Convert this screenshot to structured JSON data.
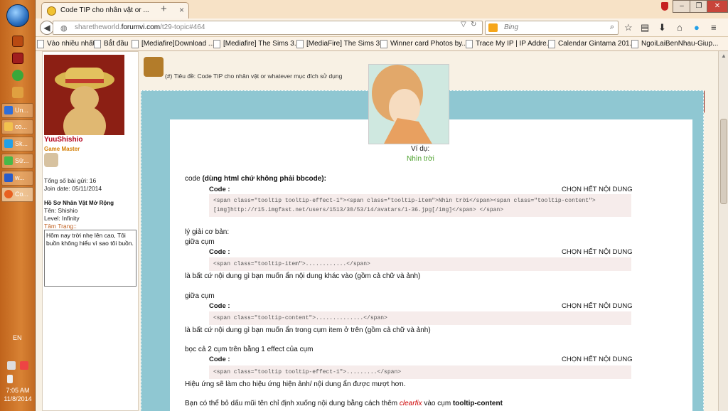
{
  "taskbar": {
    "tasks": [
      {
        "label": "Un...",
        "color": "#2f6ed8"
      },
      {
        "label": "co...",
        "color": "#f2c14e"
      },
      {
        "label": "Sk...",
        "color": "#22a0e8"
      },
      {
        "label": "Sử...",
        "color": "#48b848"
      },
      {
        "label": "w...",
        "color": "#2a5cc8"
      },
      {
        "label": "Co...",
        "color": "#e86020"
      }
    ],
    "lang": "EN",
    "time": "7:05 AM",
    "date": "11/8/2014"
  },
  "browser": {
    "tab_title": "Code TIP cho nhân vật or ...",
    "new_tab": "+",
    "url_prefix": "sharetheworld.",
    "url_domain": "forumvi.com",
    "url_path": "/t29-topic#464",
    "search_placeholder": "Bing",
    "bookmarks": [
      "Vào nhiều nhất",
      "Bắt đầu",
      "[Mediafire]Download ...",
      "[Mediafire] The Sims 3...",
      "[MediaFire] The Sims 3...",
      "Winner card Photos by...",
      "Trace My IP | IP Addre...",
      "Calendar Gintama 201...",
      "NgoiLaiBenNhau-Giup..."
    ]
  },
  "profile": {
    "username": "YuuShishio",
    "rank": "Game Master",
    "posts": "Tổng số bài gửi: 16",
    "joined": "Join date: 05/11/2014",
    "profile_title": "Hồ Sơ Nhân Vật Mở Rộng",
    "name": "Tên: Shishio",
    "level": "Level: Infinity",
    "mood_label": "Tâm Trạng::",
    "mood_text": "Hôm nay trời nhẹ lên cao, Tôi buồn không hiểu vì sao tôi buồn."
  },
  "post": {
    "topic_prefix": "(#)",
    "topic": "Tiêu đề: Code TIP cho nhân vật or whatever mục đích sử dụng",
    "tooltip_label": "Ví dụ:",
    "tooltip_item": "Nhìn trời",
    "code_intro_a": "code",
    "code_intro_b": "(dùng html chứ không phải bbcode):",
    "code_label": "Code :",
    "select_all": "CHỌN HẾT NỘI DUNG",
    "code1": "<span class=\"tooltip tooltip-effect-1\"><span class=\"tooltip-item\">Nhìn trời</span><span class=\"tooltip-content\">[img]http://r15.imgfast.net/users/1513/30/53/14/avatars/1-36.jpg[/img]</span> </span>",
    "explain": "lý giải cơ bản:",
    "between1": "giữa cụm",
    "code2": "<span class=\"tooltip-item\">............</span>",
    "explain2": "là bất cứ nội dung gì bạn muốn ẩn nội dung khác vào (gồm cả chữ và ảnh)",
    "between2": "giữa cụm",
    "code3": "<span class=\"tooltip-content\">..............</span>",
    "explain3": "là bất cứ nội dung gì bạn muốn ẩn trong cụm item ở trên (gồm cả chữ và ảnh)",
    "wrap": "bọc cả 2 cụm trên bằng 1 effect của cụm",
    "code4": "<span class=\"tooltip tooltip-effect-1\">.........</span>",
    "effect": "Hiệu ứng sẽ làm cho hiệu ứng hiện ảnh/ nội dung ẩn được mượt hơn.",
    "last_a": "Bạn có thể bỏ dấu mũi tên chỉ định xuống nội dung bằng cách thêm",
    "last_b": "clearfix",
    "last_c": "vào cụm",
    "last_d": "tooltip-content"
  }
}
